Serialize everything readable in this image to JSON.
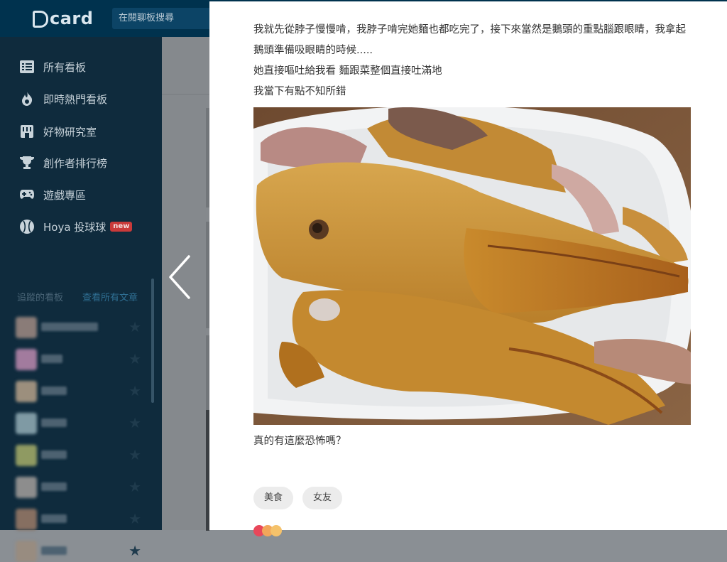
{
  "app": {
    "logo_text": "card",
    "search_placeholder": "在閱聊板搜尋"
  },
  "sidebar": {
    "items": [
      {
        "label": "所有看板",
        "icon": "list-icon"
      },
      {
        "label": "即時熱門看板",
        "icon": "flame-icon"
      },
      {
        "label": "好物研究室",
        "icon": "store-icon"
      },
      {
        "label": "創作者排行榜",
        "icon": "trophy-icon"
      },
      {
        "label": "遊戲專區",
        "icon": "gamepad-icon"
      },
      {
        "label": "Hoya 投球球",
        "icon": "baseball-icon",
        "badge": "new"
      }
    ],
    "followed_heading": "追蹤的看板",
    "view_all_label": "查看所有文章"
  },
  "post": {
    "paragraphs": [
      "我就先從脖子慢慢啃，我脖子啃完她麵也都吃完了，接下來當然是鵝頭的重點腦跟眼睛，我拿起鵝頭準備吸眼睛的時候.....",
      "她直接嘔吐給我看 麵跟菜整個直接吐滿地",
      "我當下有點不知所錯"
    ],
    "caption": "真的有這麼恐怖嗎？",
    "tags": [
      "美食",
      "女友"
    ]
  },
  "colors": {
    "topbar": "#00324e",
    "sidebar": "#0f2b3d",
    "new_badge": "#c93a3a",
    "tag_bg": "#ececec"
  }
}
